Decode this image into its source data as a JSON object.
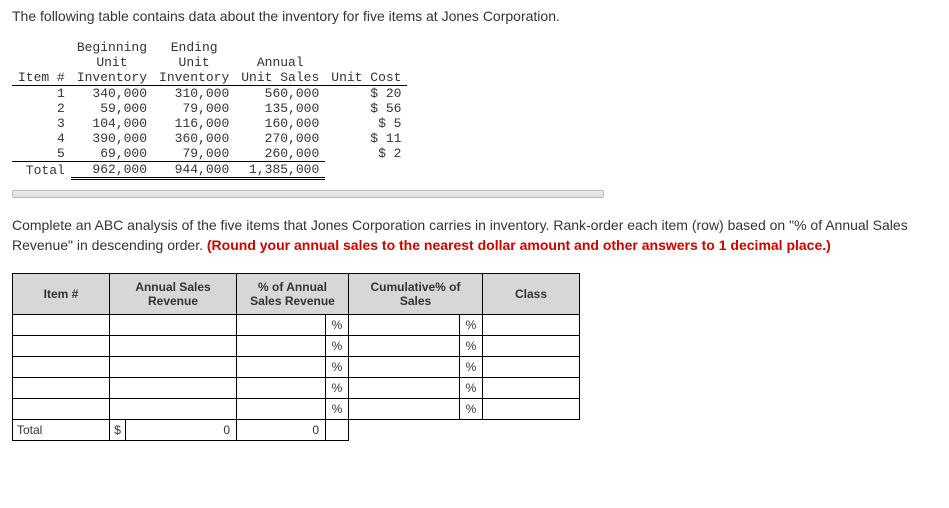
{
  "intro": "The following table contains data about the inventory for five items at Jones Corporation.",
  "headers": {
    "item": "Item #",
    "begin": "Beginning Unit Inventory",
    "beginL1": "Beginning",
    "beginL2": "Unit",
    "beginL3": "Inventory",
    "endL1": "Ending",
    "endL2": "Unit",
    "endL3": "Inventory",
    "annL1": "Annual",
    "annL2": "Unit Sales",
    "cost": "Unit Cost",
    "total": "Total"
  },
  "rows": [
    {
      "item": "1",
      "begin": "340,000",
      "end": "310,000",
      "sales": "560,000",
      "cost": "$ 20"
    },
    {
      "item": "2",
      "begin": "59,000",
      "end": "79,000",
      "sales": "135,000",
      "cost": "$ 56"
    },
    {
      "item": "3",
      "begin": "104,000",
      "end": "116,000",
      "sales": "160,000",
      "cost": "$  5"
    },
    {
      "item": "4",
      "begin": "390,000",
      "end": "360,000",
      "sales": "270,000",
      "cost": "$ 11"
    },
    {
      "item": "5",
      "begin": "69,000",
      "end": "79,000",
      "sales": "260,000",
      "cost": "$  2"
    }
  ],
  "totals": {
    "begin": "962,000",
    "end": "944,000",
    "sales": "1,385,000"
  },
  "instr1": "Complete an ABC analysis of the five items that Jones Corporation carries in inventory. Rank-order each item (row) based on \"% of Annual Sales Revenue\" in descending order. ",
  "instr2": "(Round your annual sales to the nearest dollar amount and other answers to 1 decimal place.)",
  "abc_headers": {
    "item": "Item #",
    "rev": "Annual Sales Revenue",
    "pct": "% of Annual Sales Revenue",
    "cum": "Cumulative% of Sales",
    "class": "Class"
  },
  "pct_sym": "%",
  "dollar": "$",
  "zero": "0",
  "total_label": "Total"
}
